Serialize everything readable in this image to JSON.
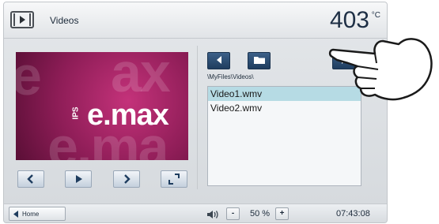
{
  "header": {
    "title": "Videos",
    "temperature": "403",
    "temperature_unit": "°C",
    "icon": "video-icon"
  },
  "player": {
    "brand": "e.max",
    "brand_prefix": "IPS",
    "controls": [
      "previous-icon",
      "play-icon",
      "next-icon",
      "fullscreen-icon"
    ]
  },
  "browser": {
    "path": "\\MyFiles\\Videos\\",
    "files": [
      "Video1.wmv",
      "Video2.wmv"
    ],
    "selected_index": 0
  },
  "footer": {
    "home_label": "Home",
    "volume_minus": "-",
    "volume_plus": "+",
    "volume": "50 %",
    "clock": "07:43:08"
  },
  "colors": {
    "accent": "#1f3d5f",
    "selection": "#b6dbe4",
    "video_bg": "#8e1d57"
  }
}
